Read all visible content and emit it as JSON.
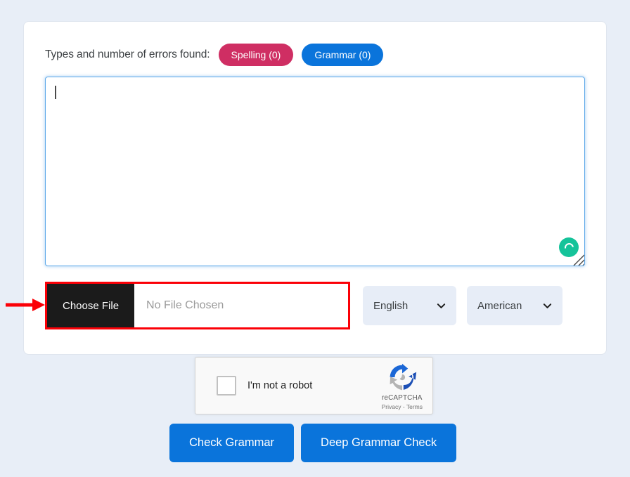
{
  "page": {
    "background_color": "#e8eef7"
  },
  "card": {
    "header": {
      "label": "Types and number of errors found:",
      "badges": [
        {
          "name": "spelling",
          "label": "Spelling (0)",
          "color": "#cf2e63"
        },
        {
          "name": "grammar",
          "label": "Grammar (0)",
          "color": "#0a74db"
        }
      ]
    },
    "editor": {
      "value": "",
      "placeholder": "",
      "focused": true,
      "assistant_indicator": "grammarly-green-circle",
      "resize_handle": true
    },
    "file_input": {
      "button_label": "Choose File",
      "file_status": "No File Chosen",
      "highlight_color": "#fb0007",
      "annotated": true
    },
    "selects": [
      {
        "name": "language",
        "value": "English"
      },
      {
        "name": "dialect",
        "value": "American"
      }
    ]
  },
  "annotation": {
    "arrow_color": "#fb0007",
    "points_to": "choose-file-button"
  },
  "recaptcha": {
    "label": "I'm not a robot",
    "checked": false,
    "brand": "reCAPTCHA",
    "links": "Privacy - Terms"
  },
  "actions": [
    {
      "name": "check-grammar",
      "label": "Check Grammar"
    },
    {
      "name": "deep-grammar-check",
      "label": "Deep Grammar Check"
    }
  ]
}
